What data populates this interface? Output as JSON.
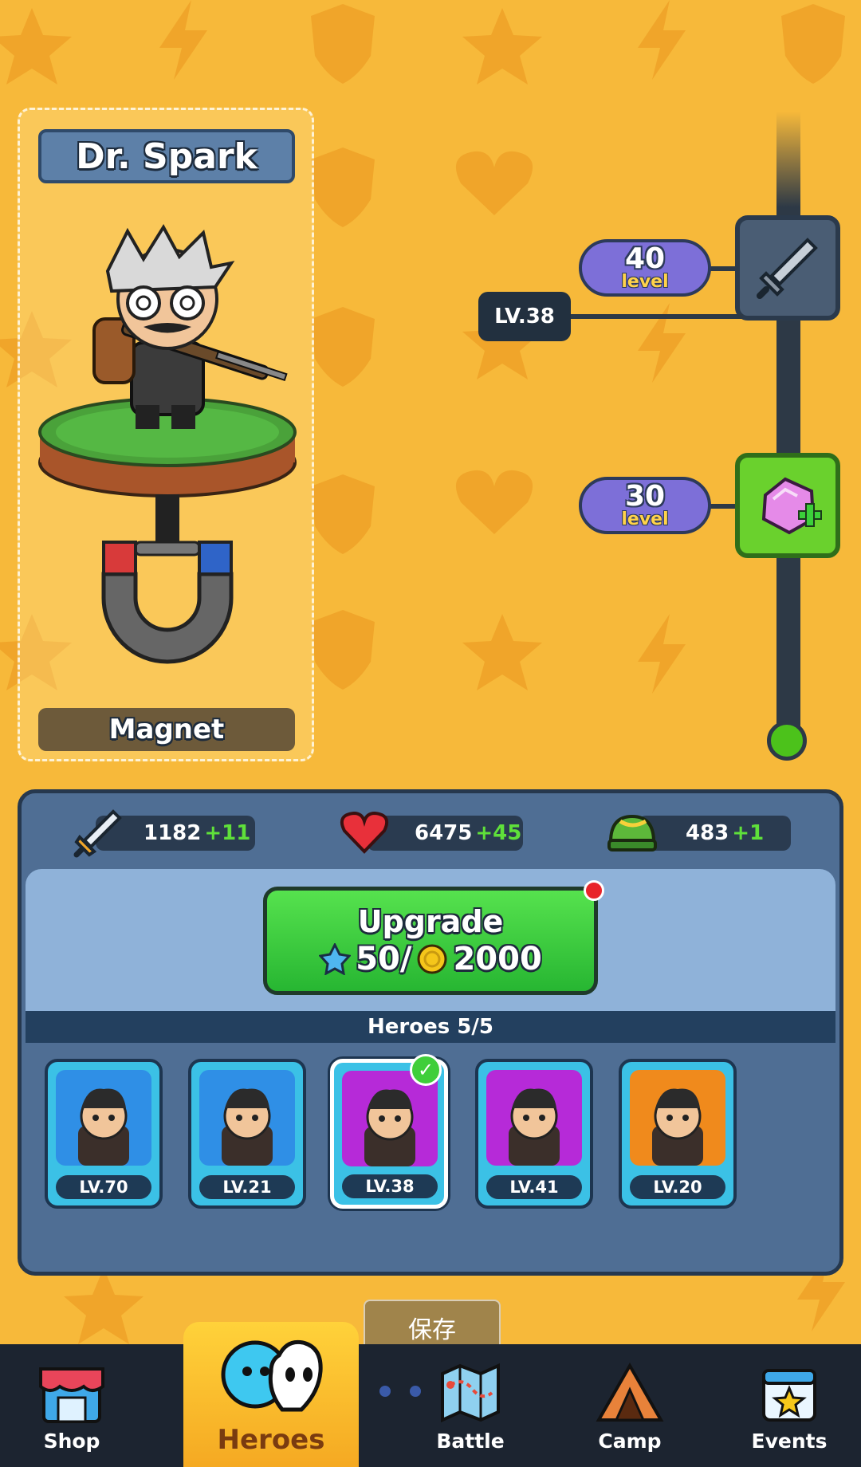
{
  "hero": {
    "name": "Dr. Spark",
    "weapon": "Magnet"
  },
  "level_track": {
    "current_level": "LV.38",
    "milestones": [
      {
        "level": "40",
        "word": "level",
        "reward_icon": "sword-icon"
      },
      {
        "level": "30",
        "word": "level",
        "reward_icon": "pink-gem-plus-icon"
      }
    ]
  },
  "stats": {
    "attack": {
      "value": "1182",
      "bonus": "+11",
      "icon": "sword-icon"
    },
    "health": {
      "value": "6475",
      "bonus": "+45",
      "icon": "heart-icon"
    },
    "armor": {
      "value": "483",
      "bonus": "+1",
      "icon": "helmet-icon"
    }
  },
  "upgrade": {
    "label": "Upgrade",
    "cost_gems": "50/",
    "cost_coins": "2000"
  },
  "heroes": {
    "title": "Heroes 5/5",
    "list": [
      {
        "level": "LV.70",
        "bg": "#2f8fe6"
      },
      {
        "level": "LV.21",
        "bg": "#2f8fe6"
      },
      {
        "level": "LV.38",
        "bg": "#b62ad8",
        "selected": true
      },
      {
        "level": "LV.41",
        "bg": "#b62ad8"
      },
      {
        "level": "LV.20",
        "bg": "#f08a1c"
      }
    ]
  },
  "toast": "保存",
  "nav": {
    "shop": "Shop",
    "heroes": "Heroes",
    "battle": "Battle",
    "camp": "Camp",
    "events": "Events"
  }
}
